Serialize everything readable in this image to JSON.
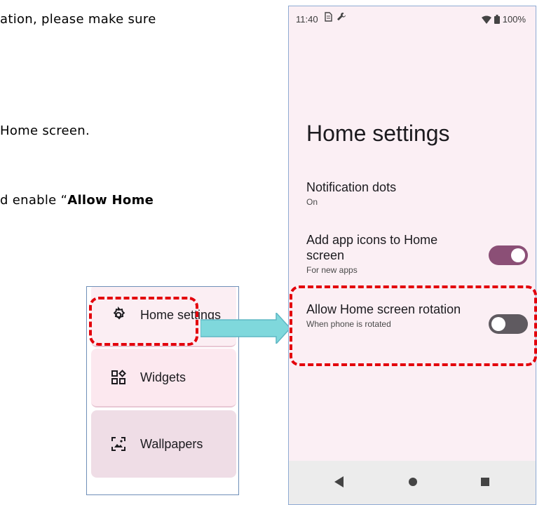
{
  "doc": {
    "line1": "ation, please make sure",
    "line2": "Home screen.",
    "line3_prefix": "d enable “",
    "line3_bold": "Allow Home"
  },
  "menu": {
    "items": [
      {
        "label": "Home settings",
        "icon": "gear-icon"
      },
      {
        "label": "Widgets",
        "icon": "widgets-icon"
      },
      {
        "label": "Wallpapers",
        "icon": "wallpaper-icon"
      }
    ]
  },
  "phone": {
    "status": {
      "time": "11:40",
      "battery": "100%"
    },
    "title": "Home settings",
    "settings": [
      {
        "title": "Notification dots",
        "subtitle": "On"
      },
      {
        "title": "Add app icons to Home screen",
        "subtitle": "For new apps",
        "toggle": "on"
      },
      {
        "title": "Allow Home screen rotation",
        "subtitle": "When phone is rotated",
        "toggle": "off"
      }
    ]
  },
  "colors": {
    "highlight": "#e3000b",
    "arrow": "#7fd8dc",
    "toggle_on": "#8b4f76",
    "toggle_off": "#5f5a60"
  }
}
